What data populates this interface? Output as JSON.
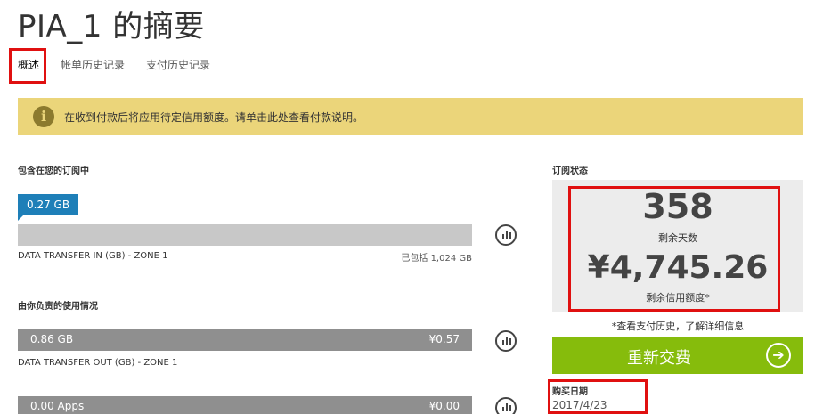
{
  "page": {
    "title": "PIA_1 的摘要"
  },
  "tabs": [
    {
      "label": "概述",
      "active": true
    },
    {
      "label": "帐单历史记录",
      "active": false
    },
    {
      "label": "支付历史记录",
      "active": false
    }
  ],
  "banner": {
    "icon": "info-icon",
    "message": "在收到付款后将应用待定信用额度。请单击此处查看付款说明。"
  },
  "included": {
    "heading": "包含在您的订阅中",
    "meters": [
      {
        "flag": "0.27 GB",
        "name": "DATA TRANSFER IN (GB) - ZONE 1",
        "note": "已包括 1,024 GB"
      }
    ]
  },
  "usage": {
    "heading": "由你负责的使用情况",
    "meters": [
      {
        "amount": "0.86 GB",
        "cost": "¥0.57",
        "name": "DATA TRANSFER OUT (GB) - ZONE 1"
      },
      {
        "amount": "0.00 Apps",
        "cost": "¥0.00"
      }
    ]
  },
  "status": {
    "heading": "订阅状态",
    "days_value": "358",
    "days_label": "剩余天数",
    "credit_value": "¥4,745.26",
    "credit_label": "剩余信用额度*",
    "note": "*查看支付历史，了解详细信息",
    "renew_label": "重新交费",
    "purchase_label": "购买日期",
    "purchase_date": "2017/4/23"
  },
  "colors": {
    "banner": "#ebd57a",
    "flag": "#1e7fb8",
    "renew": "#86bc0c",
    "highlight": "#e01010"
  }
}
